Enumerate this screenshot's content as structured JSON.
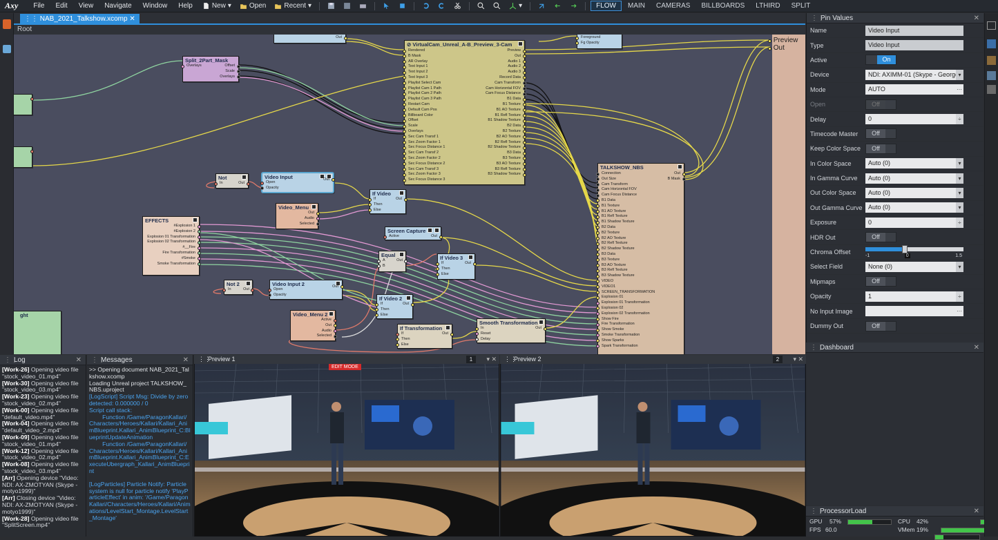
{
  "app": {
    "logo": "Axy"
  },
  "menu": [
    "File",
    "Edit",
    "View",
    "Navigate",
    "Window",
    "Help"
  ],
  "toolbar": {
    "new_label": "New",
    "open_label": "Open",
    "recent_label": "Recent"
  },
  "modes": [
    {
      "label": "FLOW",
      "active": true
    },
    {
      "label": "MAIN",
      "active": false
    },
    {
      "label": "CAMERAS",
      "active": false
    },
    {
      "label": "BILLBOARDS",
      "active": false
    },
    {
      "label": "LTHIRD",
      "active": false
    },
    {
      "label": "SPLIT",
      "active": false
    }
  ],
  "document": {
    "tab": "NAB_2021_Talkshow.xcomp",
    "breadcrumb": "Root"
  },
  "graph": {
    "preview_out": [
      "Preview",
      "Out"
    ],
    "nodes": {
      "vcam": {
        "title": "VirtualCam_Unreal_A-B_Preview_3-Cam",
        "inputs": [
          "Rendered",
          "B Mask",
          "AR Overlay",
          "Text Input 1",
          "Text Input 2",
          "Text Input 3",
          "Playlist Select Cam",
          "Playlist Cam 1 Path",
          "Playlist Cam 2 Path",
          "Playlist Cam 3 Path",
          "Restart Cam",
          "Default Cam Pos",
          "Billboard Color",
          "Offset",
          "Scale",
          "Overlays",
          "Sec Cam Transf 1",
          "Sec Zoom Factor 1",
          "Sec Focus Distance 1",
          "Sec Cam Transf 2",
          "Sec Zoom Factor 2",
          "Sec Focus Distance 2",
          "Sec Cam Transf 3",
          "Sec Zoom Factor 3",
          "Sec Focus Distance 3"
        ],
        "outputs": [
          "Preview",
          "Out",
          "Audio 1",
          "Audio 2",
          "Audio 3",
          "Record Data",
          "Cam Transform",
          "Cam Horizontal FOV",
          "Cam Focus Distance",
          "B1 Data",
          "B1 Texture",
          "B1 AO Texture",
          "B1 Refl Texture",
          "B1 Shadow Texture",
          "B2 Data",
          "B2 Texture",
          "B2 AO Texture",
          "B2 Refl Texture",
          "B2 Shadow Texture",
          "B3 Data",
          "B3 Texture",
          "B3 AO Texture",
          "B3 Refl Texture",
          "B3 Shadow Texture"
        ]
      },
      "split": {
        "title": "Split_2Part_Mask",
        "inputs": [
          "Overlays"
        ],
        "outputs": [
          "Offset",
          "Scale",
          "Overlays"
        ]
      },
      "top": {
        "outputs": [
          "Out"
        ]
      },
      "fg": {
        "inputs": [
          "Foreground",
          "Fg Opacity"
        ]
      },
      "not1": {
        "title": "Not",
        "in": "In",
        "out": "Out"
      },
      "videoinput": {
        "title": "Video Input",
        "inputs": [
          "Open",
          "Opacity"
        ],
        "outputs": [
          "Out"
        ]
      },
      "videomenu": {
        "title": "Video_Menu",
        "outputs": [
          "Out",
          "Audio",
          "Selected"
        ]
      },
      "ifvideo": {
        "title": "If Video",
        "inputs": [
          "If",
          "Then",
          "Else"
        ],
        "outputs": [
          "Out"
        ]
      },
      "effects": {
        "title": "EFFECTS",
        "outputs": [
          "#Explosion 1",
          "#Explosion 2",
          "Explosion 01 Transformation",
          "Explosion 02 Transformation",
          "#__Fire",
          "Fire Transformation",
          "#Smoke",
          "Smoke Transformation"
        ]
      },
      "screencap": {
        "title": "Screen Capture",
        "inputs": [
          "Active"
        ],
        "outputs": [
          "Out"
        ]
      },
      "equal": {
        "title": "Equal",
        "inputs": [
          "A",
          "B"
        ],
        "outputs": [
          "Out"
        ]
      },
      "ifvideo3": {
        "title": "If Video 3",
        "inputs": [
          "If",
          "Then",
          "Else"
        ],
        "outputs": [
          "Out"
        ]
      },
      "not2": {
        "title": "Not 2",
        "in": "In",
        "out": "Out"
      },
      "videoinput2": {
        "title": "Video Input 2",
        "inputs": [
          "Open",
          "Opacity"
        ],
        "outputs": [
          "Out"
        ]
      },
      "ifvideo2": {
        "title": "If Video 2",
        "inputs": [
          "If",
          "Then",
          "Else"
        ],
        "outputs": [
          "Out"
        ]
      },
      "videomenu2": {
        "title": "Video_Menu 2",
        "outputs": [
          "Active",
          "Out",
          "Audio",
          "Selected"
        ]
      },
      "iftrans": {
        "title": "If Transformation",
        "inputs": [
          "If",
          "Then",
          "Else"
        ],
        "outputs": [
          "Out"
        ]
      },
      "smooth": {
        "title": "Smooth Transformation",
        "inputs": [
          "In",
          "Reset",
          "Delay"
        ],
        "outputs": [
          "Out"
        ]
      },
      "left3": {
        "title": "ght"
      },
      "nbs": {
        "title": "TALKSHOW_NBS",
        "inputs": [
          "Connection",
          "Out Size",
          "Cam Transform",
          "Cam Horizontal FOV",
          "Cam Focus Distance",
          "B1 Data",
          "B1 Texture",
          "B1 AO Texture",
          "B1 Refl Texture",
          "B1 Shadow Texture",
          "B2 Data",
          "B2 Texture",
          "B2 AO Texture",
          "B2 Refl Texture",
          "B2 Shadow Texture",
          "B3 Data",
          "B3 Texture",
          "B3 AO Texture",
          "B3 Refl Texture",
          "B3 Shadow Texture",
          "VIDEO",
          "VIDEO1",
          "SCREEN_TRANSFORMATION",
          "Explosion 01",
          "Explosion 01 Transformation",
          "Explosion 02",
          "Explosion 02 Transformation",
          "Show Fire",
          "Fire Transformation",
          "Show Smoke",
          "Smoke Transformation",
          "Show Sparks",
          "Spark Transformation"
        ],
        "outputs": [
          "Out",
          "B Mask"
        ]
      }
    }
  },
  "pin_values": {
    "title": "Pin Values",
    "rows": [
      {
        "label": "Name",
        "kind": "text",
        "value": "Video Input",
        "highlight": true
      },
      {
        "label": "Type",
        "kind": "text",
        "value": "Video Input",
        "highlight": true
      },
      {
        "label": "Active",
        "kind": "toggle-on",
        "value": "On"
      },
      {
        "label": "Device",
        "kind": "dropdown",
        "value": "NDI: AXIMM-01 (Skype - George"
      },
      {
        "label": "Mode",
        "kind": "dots",
        "value": "AUTO"
      },
      {
        "label": "Open",
        "kind": "toggle-dis",
        "value": "Off",
        "dim": true
      },
      {
        "label": "Delay",
        "kind": "number",
        "value": "0"
      },
      {
        "label": "Timecode Master",
        "kind": "toggle",
        "value": "Off"
      },
      {
        "label": "Keep Color Space",
        "kind": "toggle",
        "value": "Off"
      },
      {
        "label": "In Color Space",
        "kind": "dropdown",
        "value": "Auto (0)"
      },
      {
        "label": "In Gamma Curve",
        "kind": "dropdown",
        "value": "Auto (0)"
      },
      {
        "label": "Out Color Space",
        "kind": "dropdown",
        "value": "Auto (0)"
      },
      {
        "label": "Out Gamma Curve",
        "kind": "dropdown",
        "value": "Auto (0)"
      },
      {
        "label": "Exposure",
        "kind": "number",
        "value": "0"
      },
      {
        "label": "HDR Out",
        "kind": "toggle",
        "value": "Off"
      },
      {
        "label": "Chroma Offset",
        "kind": "slider",
        "value": "0",
        "min": "-1",
        "max": "1.5",
        "fraction": 0.4
      },
      {
        "label": "Select Field",
        "kind": "dropdown",
        "value": "None (0)"
      },
      {
        "label": "Mipmaps",
        "kind": "toggle",
        "value": "Off"
      },
      {
        "label": "Opacity",
        "kind": "number",
        "value": "1"
      },
      {
        "label": "No Input Image",
        "kind": "dots",
        "value": ""
      },
      {
        "label": "Dummy Out",
        "kind": "toggle",
        "value": "Off"
      }
    ]
  },
  "dashboard": {
    "title": "Dashboard"
  },
  "processor": {
    "title": "ProcessorLoad",
    "gpu_label": "GPU",
    "gpu": "57%",
    "gpu_frac": 0.57,
    "cpu_label": "CPU",
    "cpu": "42%",
    "cpu_frac": 0.42,
    "fps_label": "FPS",
    "fps": "60.0",
    "fps_frac": 1.0,
    "vmem_label": "VMem",
    "vmem": "19%",
    "vmem_frac": 0.19
  },
  "log": {
    "title": "Log",
    "lines": [
      {
        "tag": "[Work-26]",
        "text": " Opening video file \"stock_video_01.mp4\""
      },
      {
        "tag": "[Work-30]",
        "text": " Opening video file \"stock_video_03.mp4\""
      },
      {
        "tag": "[Work-23]",
        "text": " Opening video file \"stock_video_02.mp4\""
      },
      {
        "tag": "[Work-00]",
        "text": " Opening video file \"default_video.mp4\""
      },
      {
        "tag": "[Work-04]",
        "text": " Opening video file \"default_video_2.mp4\""
      },
      {
        "tag": "[Work-09]",
        "text": " Opening video file \"stock_video_01.mp4\""
      },
      {
        "tag": "[Work-12]",
        "text": " Opening video file \"stock_video_02.mp4\""
      },
      {
        "tag": "[Work-08]",
        "text": " Opening video file \"stock_video_03.mp4\""
      },
      {
        "tag": "[Arr]",
        "text": " Opening device \"Video: NDI: AX-ZMOTYAN (Skype - motyo1999)\""
      },
      {
        "tag": "[Arr]",
        "text": " Closing device \"Video: NDI: AX-ZMOTYAN (Skype - motyo1999)\""
      },
      {
        "tag": "[Work-28]",
        "text": " Opening video file \"SplitScreen.mp4\""
      }
    ]
  },
  "messages": {
    "title": "Messages",
    "lines": [
      {
        "color": "w",
        "text": ">> Opening document NAB_2021_Talkshow.xcomp"
      },
      {
        "color": "w",
        "text": "Loading Unreal project TALKSHOW_NBS.uproject"
      },
      {
        "color": "b",
        "text": "[LogScript] Script Msg: Divide by zero detected: 0.000000 / 0"
      },
      {
        "color": "b",
        "text": "Script call stack:"
      },
      {
        "color": "b",
        "text": "        Function /Game/ParagonKallari/Characters/Heroes/Kallari/Kallari_AnimBlueprint.Kallari_AnimBlueprint_C:BlueprintUpdateAnimation"
      },
      {
        "color": "b",
        "text": "        Function /Game/ParagonKallari/Characters/Heroes/Kallari/Kallari_AnimBlueprint.Kallari_AnimBlueprint_C:ExecuteUbergraph_Kallari_AnimBlueprint"
      },
      {
        "color": "b",
        "text": ""
      },
      {
        "color": "b",
        "text": "[LogParticles] Particle Notify: Particle system is null for particle notify 'PlayParticleEffect' in anim: '/Game/ParagonKallari/Characters/Heroes/Kallari/Animations/LevelStart_Montage.LevelStart_Montage'"
      }
    ]
  },
  "preview1": {
    "title": "Preview 1",
    "num": "1",
    "badge": "EDIT MODE"
  },
  "preview2": {
    "title": "Preview 2",
    "num": "2"
  },
  "colors": {
    "accent": "#2f8fdc",
    "canvas": "#4a4d5f",
    "wire_yellow": "#e6d84a",
    "wire_pink": "#e39ad4",
    "wire_green": "#8fd4a0",
    "wire_black": "#111111",
    "wire_red": "#e07a6a"
  }
}
